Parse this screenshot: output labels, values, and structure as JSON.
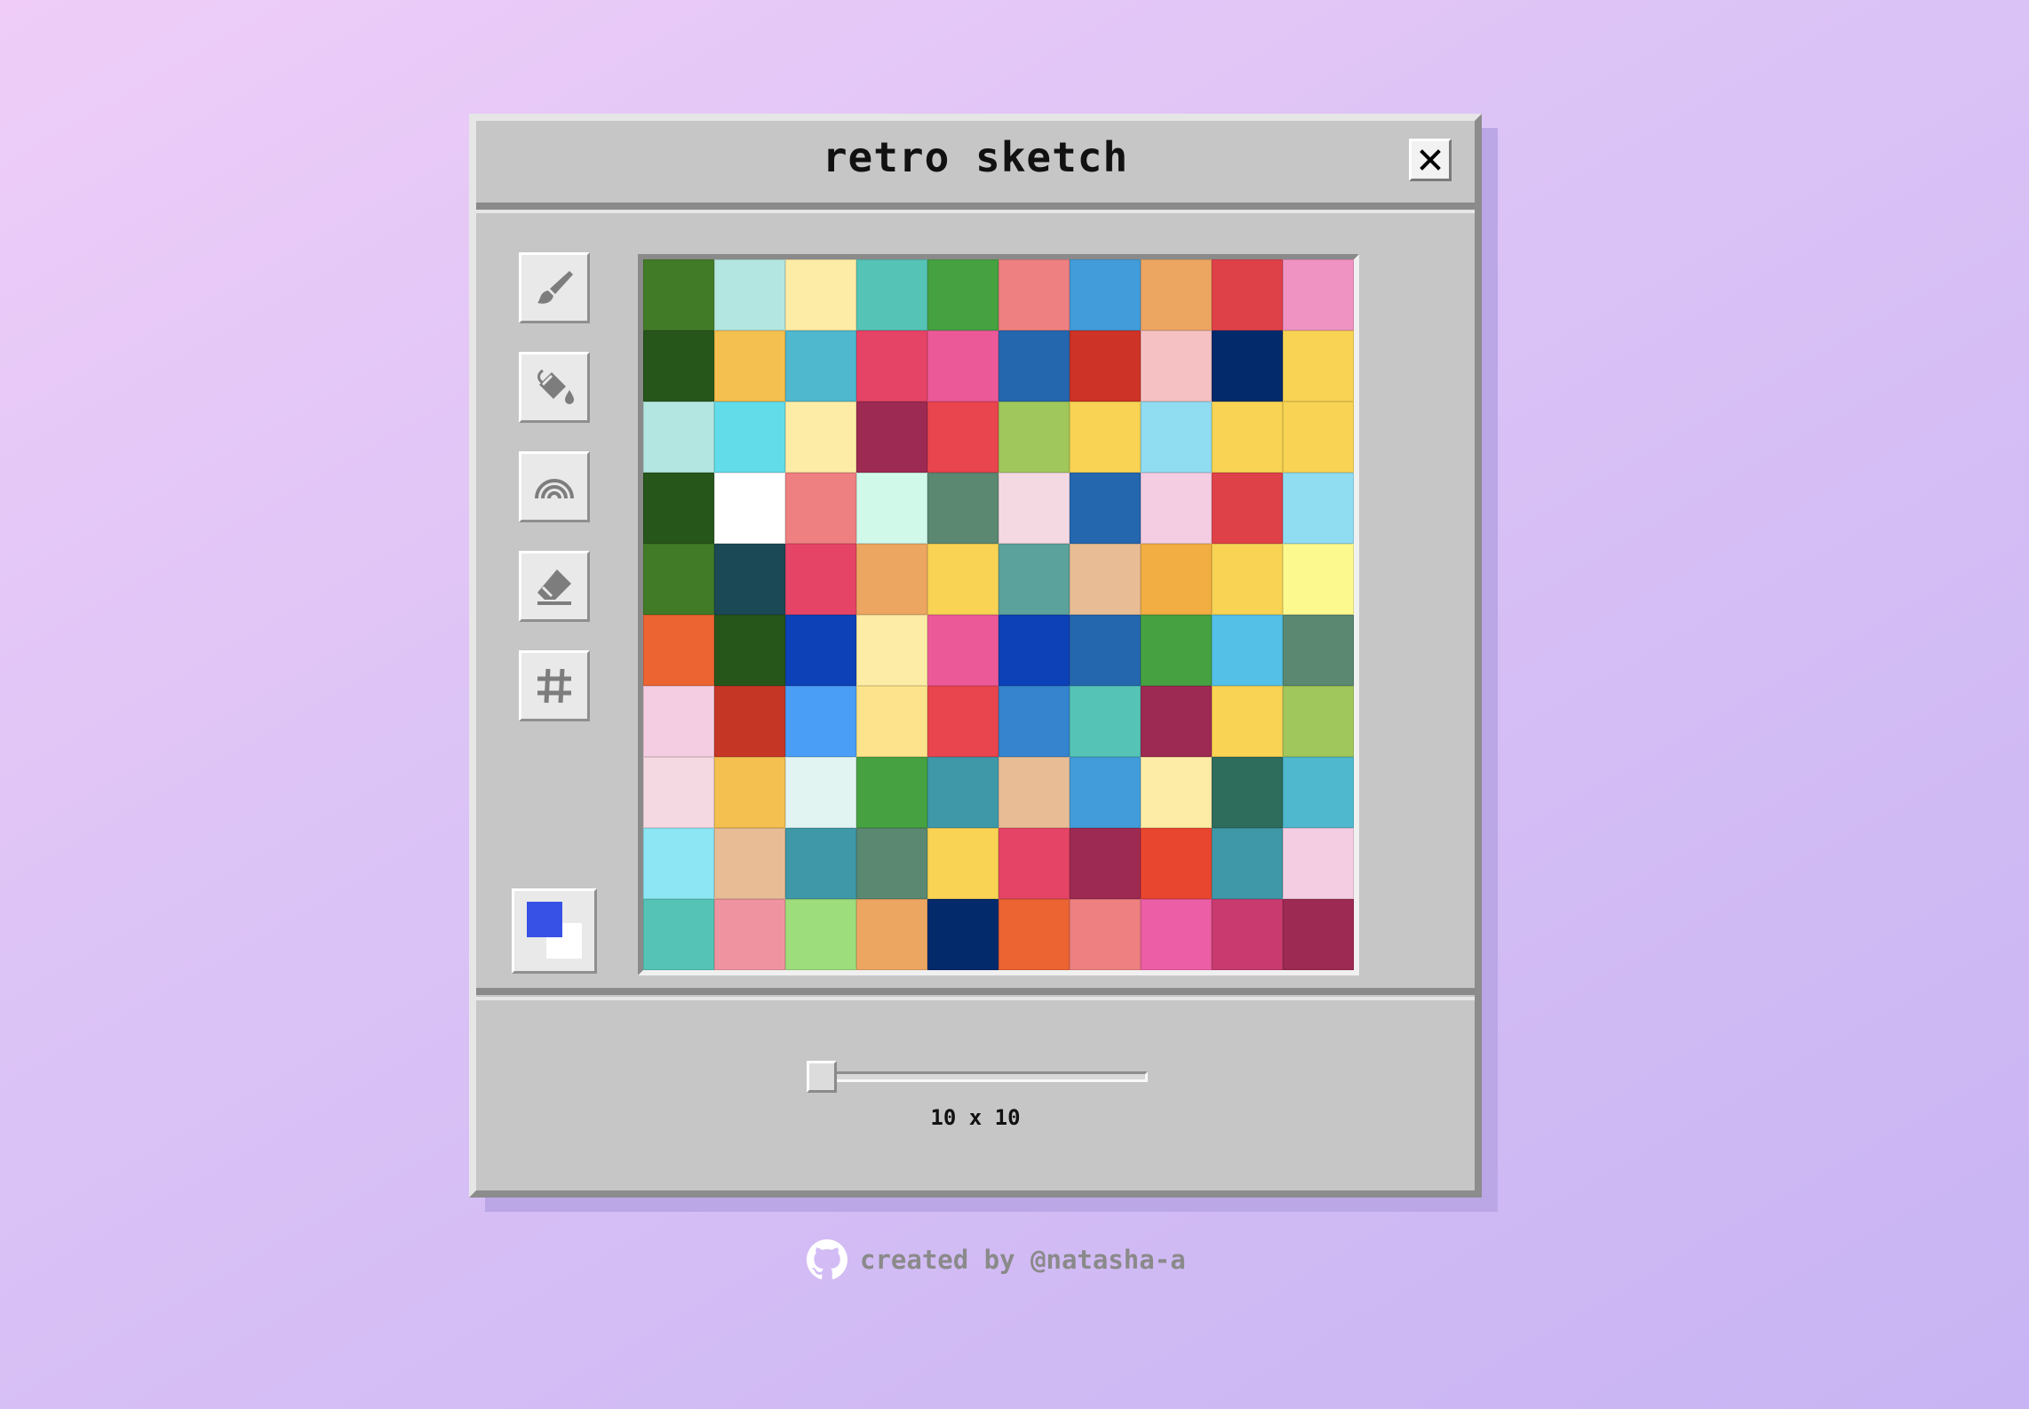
{
  "window": {
    "title": "retro sketch",
    "close_icon": "close-icon"
  },
  "toolbar": {
    "tools": [
      {
        "name": "brush",
        "icon": "paintbrush-icon"
      },
      {
        "name": "fill",
        "icon": "paint-bucket-icon"
      },
      {
        "name": "rainbow",
        "icon": "rainbow-icon"
      },
      {
        "name": "eraser",
        "icon": "eraser-icon"
      },
      {
        "name": "grid-toggle",
        "icon": "hashtag-grid-icon"
      }
    ]
  },
  "colors": {
    "primary": "#3751e6",
    "secondary": "#ffffff"
  },
  "canvas": {
    "rows": 10,
    "cols": 10,
    "cells": [
      [
        "#427b27",
        "#b3e6e0",
        "#fdeca5",
        "#55c4b7",
        "#46a141",
        "#ee8081",
        "#429cd9",
        "#eca662",
        "#df4148",
        "#ef93c3"
      ],
      [
        "#27561b",
        "#f4c04f",
        "#4fb8ce",
        "#e54466",
        "#ec5998",
        "#2467ae",
        "#cd3326",
        "#f5c1c3",
        "#032a6b",
        "#f8d354"
      ],
      [
        "#b3e6e0",
        "#62dce9",
        "#fdeca5",
        "#9d2a52",
        "#e9454e",
        "#a0c75b",
        "#f8d354",
        "#90dcf1",
        "#f8d354",
        "#f8d354"
      ],
      [
        "#27561b",
        "#ffffff",
        "#ee8081",
        "#d0f9ea",
        "#5a8871",
        "#f5d9e2",
        "#2467ae",
        "#f5cde2",
        "#df4148",
        "#90dcf1"
      ],
      [
        "#427b27",
        "#1b4955",
        "#e54466",
        "#eca662",
        "#f8d354",
        "#5ba19c",
        "#e8bd95",
        "#f2ae43",
        "#f8d354",
        "#fcf98f"
      ],
      [
        "#eb6431",
        "#27561b",
        "#0d41b7",
        "#fdeca5",
        "#ec5998",
        "#0d41b7",
        "#2467ae",
        "#46a141",
        "#55c0e7",
        "#5a8871"
      ],
      [
        "#f5cde2",
        "#c63625",
        "#4a9ef5",
        "#fde38b",
        "#e9454e",
        "#3584cd",
        "#55c4b7",
        "#9d2a52",
        "#f8d354",
        "#a0c75b"
      ],
      [
        "#f5d9e2",
        "#f4c04f",
        "#e1f4f2",
        "#46a141",
        "#3f98a8",
        "#e8bd95",
        "#429cd9",
        "#fdeca5",
        "#2e6d5b",
        "#4fb8ce"
      ],
      [
        "#8ce6f4",
        "#e8bd95",
        "#3f98a8",
        "#5a8871",
        "#f8d354",
        "#e54466",
        "#9d2a52",
        "#e9462f",
        "#3f98a8",
        "#f5cde2"
      ],
      [
        "#55c4b7",
        "#f093a1",
        "#9edd7c",
        "#eca662",
        "#032a6b",
        "#eb6431",
        "#ee8081",
        "#ec5ea6",
        "#c93b6f",
        "#9d2a52"
      ]
    ]
  },
  "slider": {
    "value": 10,
    "label": "10 x 10"
  },
  "footer": {
    "credit_text": "created by @natasha-a",
    "icon": "github-icon"
  }
}
